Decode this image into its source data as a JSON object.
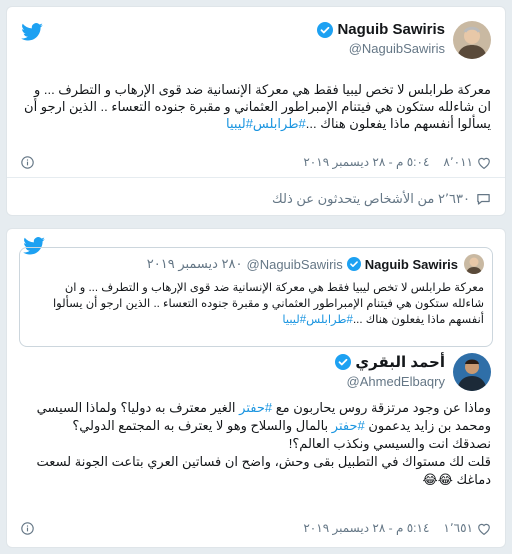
{
  "tweet1": {
    "display_name": "Naguib Sawiris",
    "handle": "@NaguibSawiris",
    "text_lines": [
      "معركة طرابلس لا تخص ليبيا فقط هي معركة الإنسانية ضد قوى الإرهاب و التطرف ... و",
      "ان شاءلله ستكون هي فيتنام الإمبراطور  العثماني و مقبرة جنوده التعساء .. الذين ارجو أن",
      "يسألوا أنفسهم ماذا يفعلون هناك ...#طرابلس#ليبيا"
    ],
    "like_count": "٨٬٠١١",
    "timestamp": "٥:٠٤ م - ٢٨ ديسمبر ٢٠١٩",
    "people_talking": "٢٬٦٣٠ من الأشخاص يتحدثون عن ذلك"
  },
  "tweet2": {
    "quoted": {
      "display_name": "Naguib Sawiris",
      "handle": "@NaguibSawiris",
      "date": "٢٨٠ ديسمبر ٢٠١٩",
      "text_lines": [
        "معركة طرابلس لا تخص ليبيا فقط هي معركة الإنسانية ضد قوى الإرهاب و التطرف ... و ان",
        "شاءلله ستكون هي فيتنام الإمبراطور  العثماني و مقبرة جنوده التعساء .. الذين ارجو أن يسألوا",
        "أنفسهم ماذا يفعلون هناك ...#طرابلس#ليبيا"
      ]
    },
    "display_name": "أحمد البقري",
    "handle": "@AhmedElbaqry",
    "text_lines": [
      "وماذا عن وجود مرتزقة روس يحاربون مع #حفتر الغير معترف به دوليا؟ ولماذا السيسي",
      "ومحمد بن زايد يدعمون #حفتر بالمال والسلاح وهو لا يعترف به المجتمع الدولي؟",
      "نصدقك انت والسيسي ونكذب العالم؟!",
      "قلت لك مستواك في التطبيل بقى وحش، واضح ان فساتين العري بتاعت الجونة لسعت",
      "دماغك 😂😂"
    ],
    "like_count": "١٬٦٥١",
    "timestamp": "٥:١٤ م - ٢٨ ديسمبر ٢٠١٩"
  },
  "colors": {
    "twitter_blue": "#1da1f2",
    "hashtag": "#1b95e0",
    "muted": "#657786",
    "text": "#14171a",
    "border": "#dfe5e9",
    "background": "#e6ecf0"
  },
  "icons": {
    "brand": "twitter-bird-icon",
    "verified": "verified-badge-icon",
    "like": "heart-icon",
    "info": "info-icon",
    "people": "speech-bubble-icon"
  }
}
